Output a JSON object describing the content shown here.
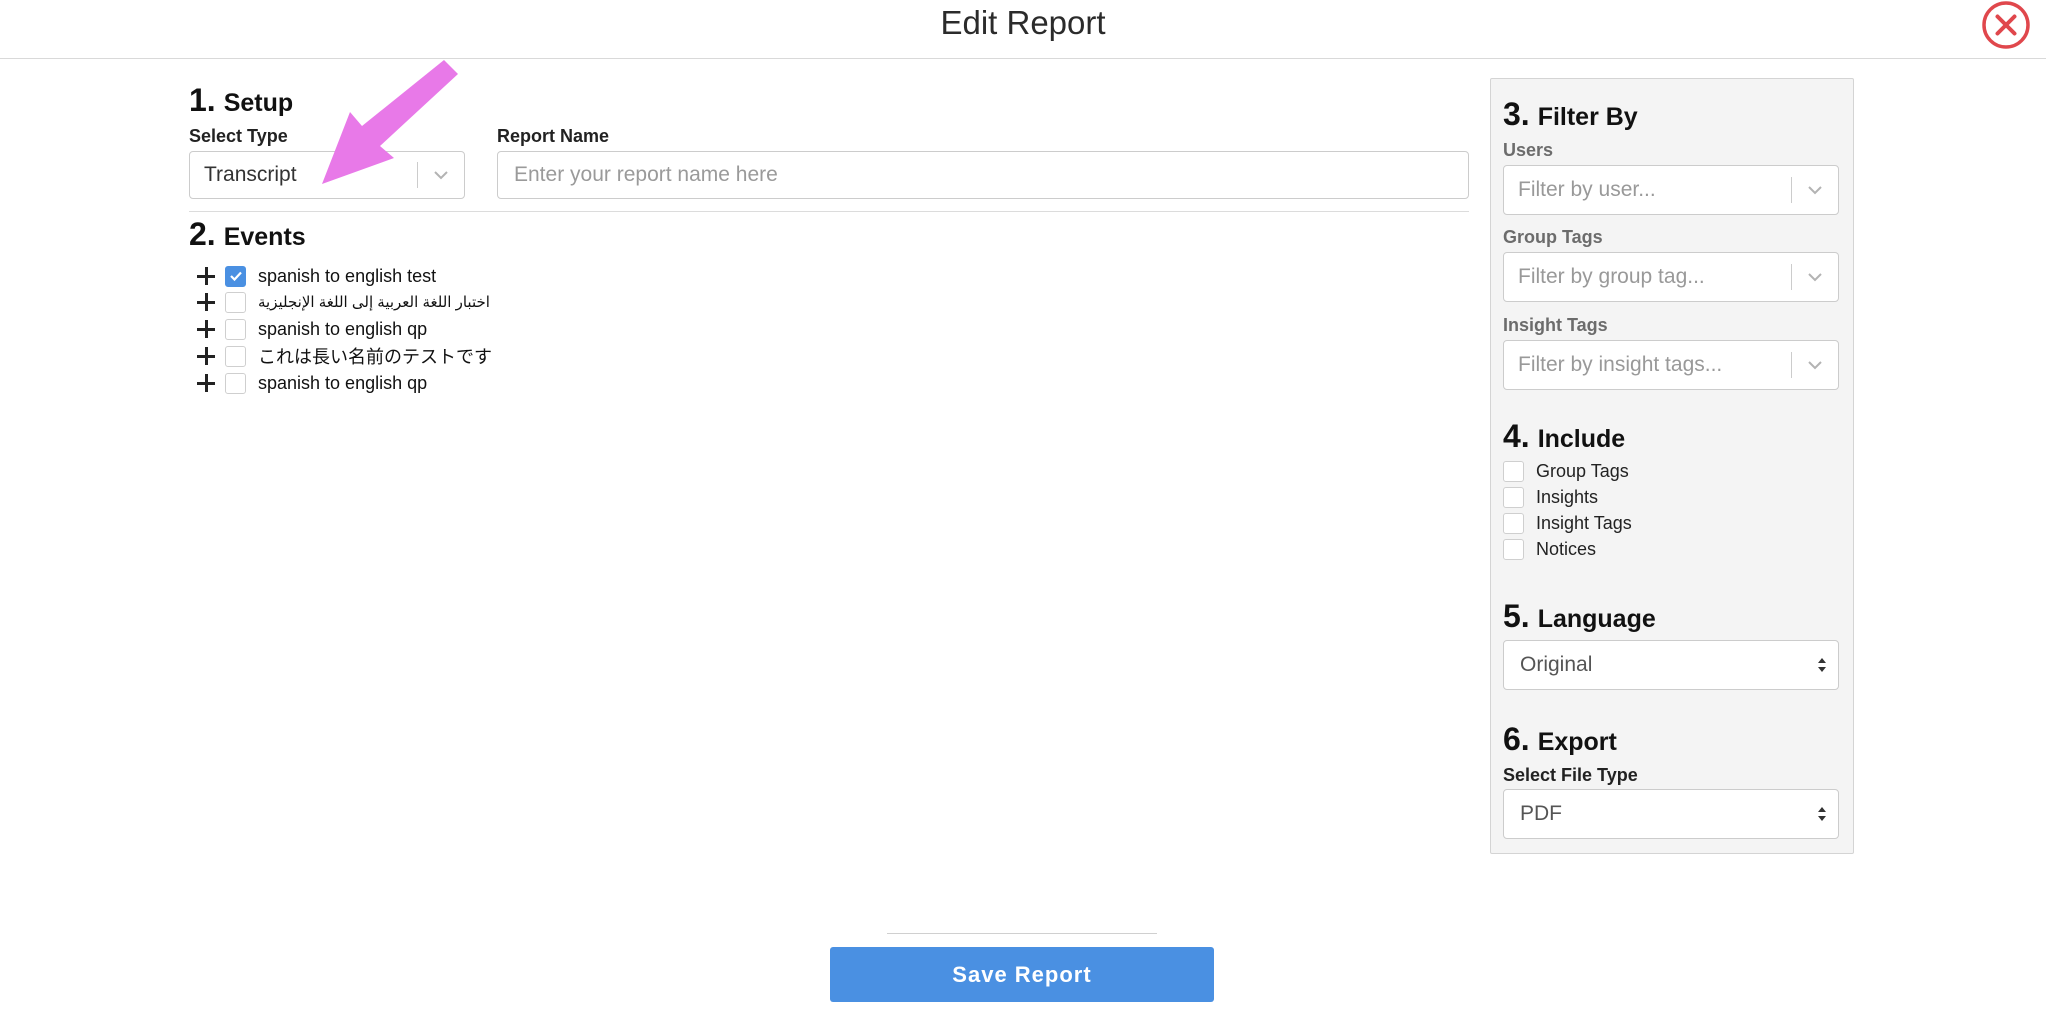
{
  "header": {
    "title": "Edit Report"
  },
  "setup": {
    "number": "1.",
    "title": "Setup",
    "select_type_label": "Select Type",
    "select_type_value": "Transcript",
    "report_name_label": "Report Name",
    "report_name_placeholder": "Enter your report name here",
    "report_name_value": ""
  },
  "events": {
    "number": "2.",
    "title": "Events",
    "items": [
      {
        "label": "spanish to english test",
        "checked": true
      },
      {
        "label": "اختبار اللغة العربية إلى اللغة الإنجليزية",
        "checked": false
      },
      {
        "label": "spanish to english qp",
        "checked": false
      },
      {
        "label": "これは長い名前のテストです",
        "checked": false
      },
      {
        "label": "spanish to english qp",
        "checked": false
      }
    ]
  },
  "filter_by": {
    "number": "3.",
    "title": "Filter By",
    "users_label": "Users",
    "users_placeholder": "Filter by user...",
    "group_tags_label": "Group Tags",
    "group_tags_placeholder": "Filter by group tag...",
    "insight_tags_label": "Insight Tags",
    "insight_tags_placeholder": "Filter by insight tags..."
  },
  "include": {
    "number": "4.",
    "title": "Include",
    "items": [
      {
        "label": "Group Tags",
        "checked": false
      },
      {
        "label": "Insights",
        "checked": false
      },
      {
        "label": "Insight Tags",
        "checked": false
      },
      {
        "label": "Notices",
        "checked": false
      }
    ]
  },
  "language": {
    "number": "5.",
    "title": "Language",
    "value": "Original"
  },
  "export": {
    "number": "6.",
    "title": "Export",
    "file_type_label": "Select File Type",
    "file_type_value": "PDF"
  },
  "footer": {
    "save_label": "Save Report"
  },
  "colors": {
    "accent": "#4a90e2",
    "close": "#e0474c",
    "annotation_arrow": "#e879e8"
  }
}
